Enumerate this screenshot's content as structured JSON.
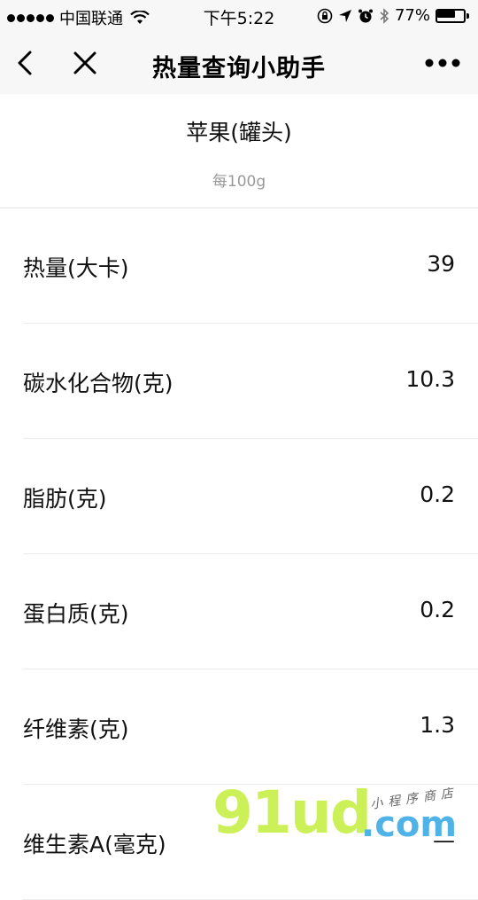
{
  "status_bar": {
    "carrier": "中国联通",
    "time": "下午5:22",
    "battery_percent": "77%",
    "battery_level": 0.77
  },
  "nav": {
    "title": "热量查询小助手"
  },
  "food": {
    "name": "苹果(罐头)",
    "unit": "每100g"
  },
  "nutrients": [
    {
      "label": "热量(大卡)",
      "value": "39"
    },
    {
      "label": "碳水化合物(克)",
      "value": "10.3"
    },
    {
      "label": "脂肪(克)",
      "value": "0.2"
    },
    {
      "label": "蛋白质(克)",
      "value": "0.2"
    },
    {
      "label": "纤维素(克)",
      "value": "1.3"
    },
    {
      "label": "维生素A(毫克)",
      "value": "—"
    }
  ],
  "watermark": {
    "main": "91ud",
    "domain": ".com",
    "tagline": "小程序商店"
  }
}
